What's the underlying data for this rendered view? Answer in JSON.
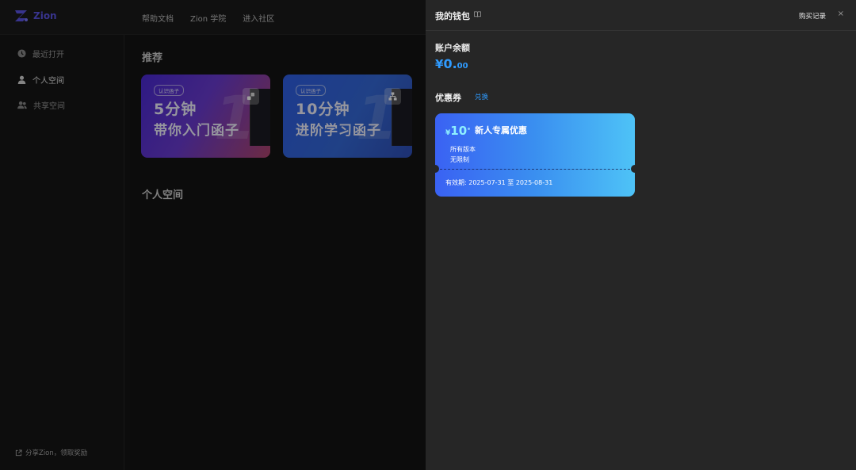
{
  "app": {
    "logo_text": "Zion"
  },
  "topnav": [
    {
      "label": "帮助文档"
    },
    {
      "label": "Zion 学院"
    },
    {
      "label": "进入社区"
    }
  ],
  "sidebar": {
    "items": [
      {
        "label": "最近打开",
        "icon": "clock-icon"
      },
      {
        "label": "个人空间",
        "icon": "person-icon"
      },
      {
        "label": "共享空间",
        "icon": "people-icon"
      }
    ],
    "share_label": "分享Zion，领取奖励"
  },
  "main": {
    "recommend_title": "推荐",
    "cards": [
      {
        "tag": "认识函子",
        "line1": "5分钟",
        "line2": "带你入门函子"
      },
      {
        "tag": "认识函子",
        "line1": "10分钟",
        "line2": "进阶学习函子"
      }
    ],
    "personal_title": "个人空间"
  },
  "wallet": {
    "title": "我的钱包",
    "purchase_label": "购买记录",
    "close_label": "×",
    "balance_label": "账户余额",
    "balance_symbol": "¥",
    "balance_int": "0.",
    "balance_dec": "00",
    "coupons_label": "优惠券",
    "redeem_label": "兑换",
    "coupon": {
      "symbol": "¥",
      "amount": "10",
      "name": "新人专属优惠",
      "scope1": "所有版本",
      "scope2": "无限制",
      "validity": "有效期: 2025-07-31 至 2025-08-31"
    }
  },
  "colors": {
    "accent": "#2f9bff",
    "logo": "#5b55e6",
    "drawer_bg": "#262626"
  }
}
